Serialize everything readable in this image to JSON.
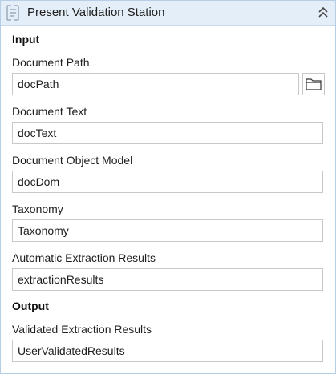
{
  "activity": {
    "title": "Present Validation Station",
    "title_icon": "activity-list-icon",
    "collapse_icon": "double-chevron-up-icon"
  },
  "input_section": {
    "header": "Input",
    "fields": [
      {
        "label": "Document Path",
        "value": "docPath",
        "has_browse": true,
        "browse_icon": "folder-icon"
      },
      {
        "label": "Document Text",
        "value": "docText"
      },
      {
        "label": "Document Object Model",
        "value": "docDom"
      },
      {
        "label": "Taxonomy",
        "value": "Taxonomy"
      },
      {
        "label": "Automatic Extraction Results",
        "value": "extractionResults"
      }
    ]
  },
  "output_section": {
    "header": "Output",
    "fields": [
      {
        "label": "Validated Extraction Results",
        "value": "UserValidatedResults"
      }
    ]
  },
  "colors": {
    "title_bar": "#e4eef8",
    "border": "#b7cfe6",
    "input_border": "#c8c8c8"
  }
}
